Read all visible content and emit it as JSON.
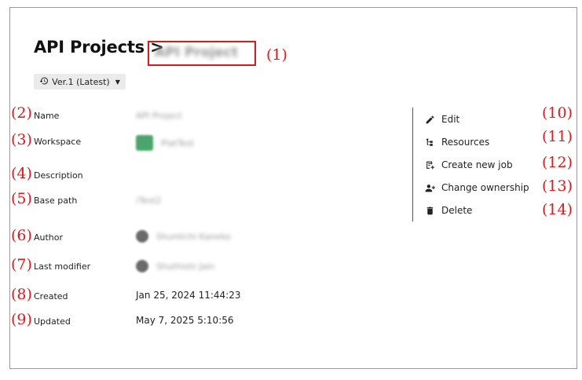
{
  "breadcrumb": {
    "parent": "API Projects >",
    "current": "API Project"
  },
  "version": {
    "label": "Ver.1 (Latest)"
  },
  "fields": {
    "name": {
      "label": "Name",
      "value": "API Project"
    },
    "workspace": {
      "label": "Workspace",
      "value": "PlatTest"
    },
    "description": {
      "label": "Description",
      "value": ""
    },
    "base_path": {
      "label": "Base path",
      "value": "/Test2"
    },
    "author": {
      "label": "Author",
      "value": "Shuntichi Kaneko"
    },
    "last_modifier": {
      "label": "Last modifier",
      "value": "Shuthishi Jain"
    },
    "created": {
      "label": "Created",
      "value": "Jan 25, 2024 11:44:23"
    },
    "updated": {
      "label": "Updated",
      "value": "May 7, 2025 5:10:56"
    }
  },
  "actions": [
    {
      "label": "Edit",
      "icon": "pencil-icon"
    },
    {
      "label": "Resources",
      "icon": "tree-icon"
    },
    {
      "label": "Create new job",
      "icon": "new-job-icon"
    },
    {
      "label": "Change ownership",
      "icon": "person-add-icon"
    },
    {
      "label": "Delete",
      "icon": "trash-icon"
    }
  ],
  "callouts": [
    "(1)",
    "(2)",
    "(3)",
    "(4)",
    "(5)",
    "(6)",
    "(7)",
    "(8)",
    "(9)",
    "(10)",
    "(11)",
    "(12)",
    "(13)",
    "(14)"
  ],
  "colors": {
    "callout": "#e3161b",
    "workspace_avatar": "#4aa56b",
    "button_bg": "#ebebeb"
  }
}
